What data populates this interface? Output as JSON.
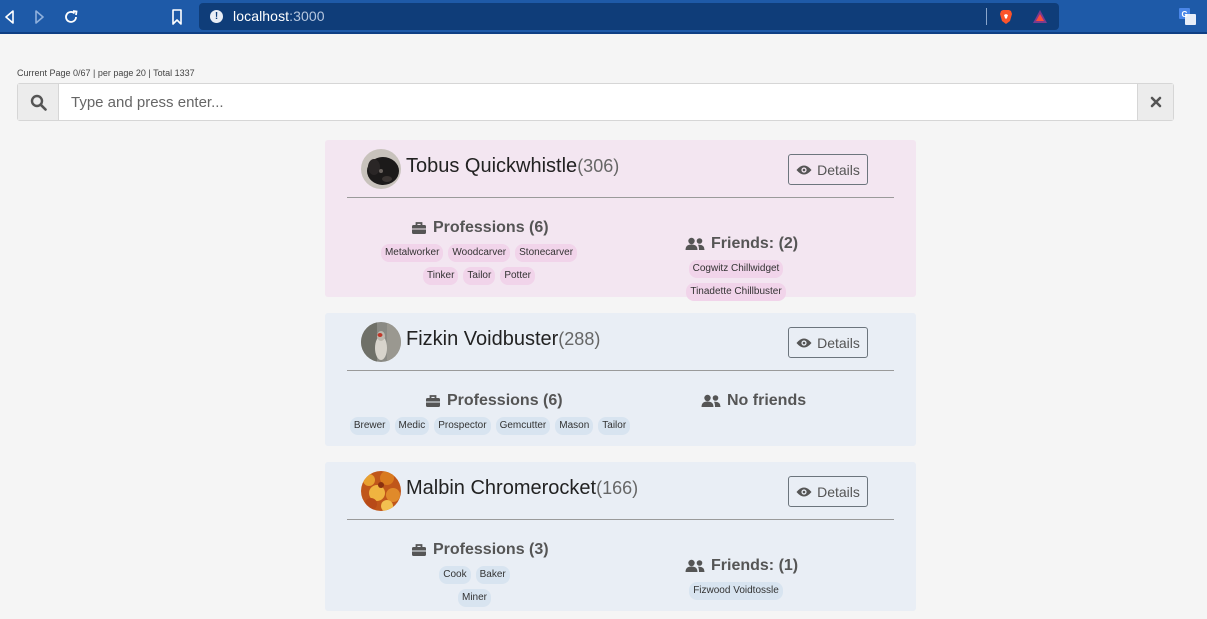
{
  "browser": {
    "host": "localhost",
    "port": ":3000"
  },
  "page": {
    "meta": "Current Page 0/67 | per page 20 | Total 1337",
    "search_placeholder": "Type and press enter..."
  },
  "colors": {
    "card_pink": "#f3e6f1",
    "card_blue": "#e9eef5",
    "chrome_blue": "#1e5aa8"
  },
  "cards": [
    {
      "name": "Tobus Quickwhistle",
      "count": "(306)",
      "details_label": "Details",
      "professions_title": "Professions (6)",
      "professions": [
        "Metalworker",
        "Woodcarver",
        "Stonecarver",
        "Tinker",
        "Tailor",
        "Potter"
      ],
      "friends_title": "Friends: (2)",
      "friends": [
        "Cogwitz Chillwidget",
        "Tinadette Chillbuster"
      ]
    },
    {
      "name": "Fizkin Voidbuster",
      "count": "(288)",
      "details_label": "Details",
      "professions_title": "Professions (6)",
      "professions": [
        "Brewer",
        "Medic",
        "Prospector",
        "Gemcutter",
        "Mason",
        "Tailor"
      ],
      "friends_title": "No friends",
      "friends": []
    },
    {
      "name": "Malbin Chromerocket",
      "count": "(166)",
      "details_label": "Details",
      "professions_title": "Professions (3)",
      "professions": [
        "Cook",
        "Baker",
        "Miner"
      ],
      "friends_title": "Friends: (1)",
      "friends": [
        "Fizwood Voidtossle"
      ]
    }
  ]
}
